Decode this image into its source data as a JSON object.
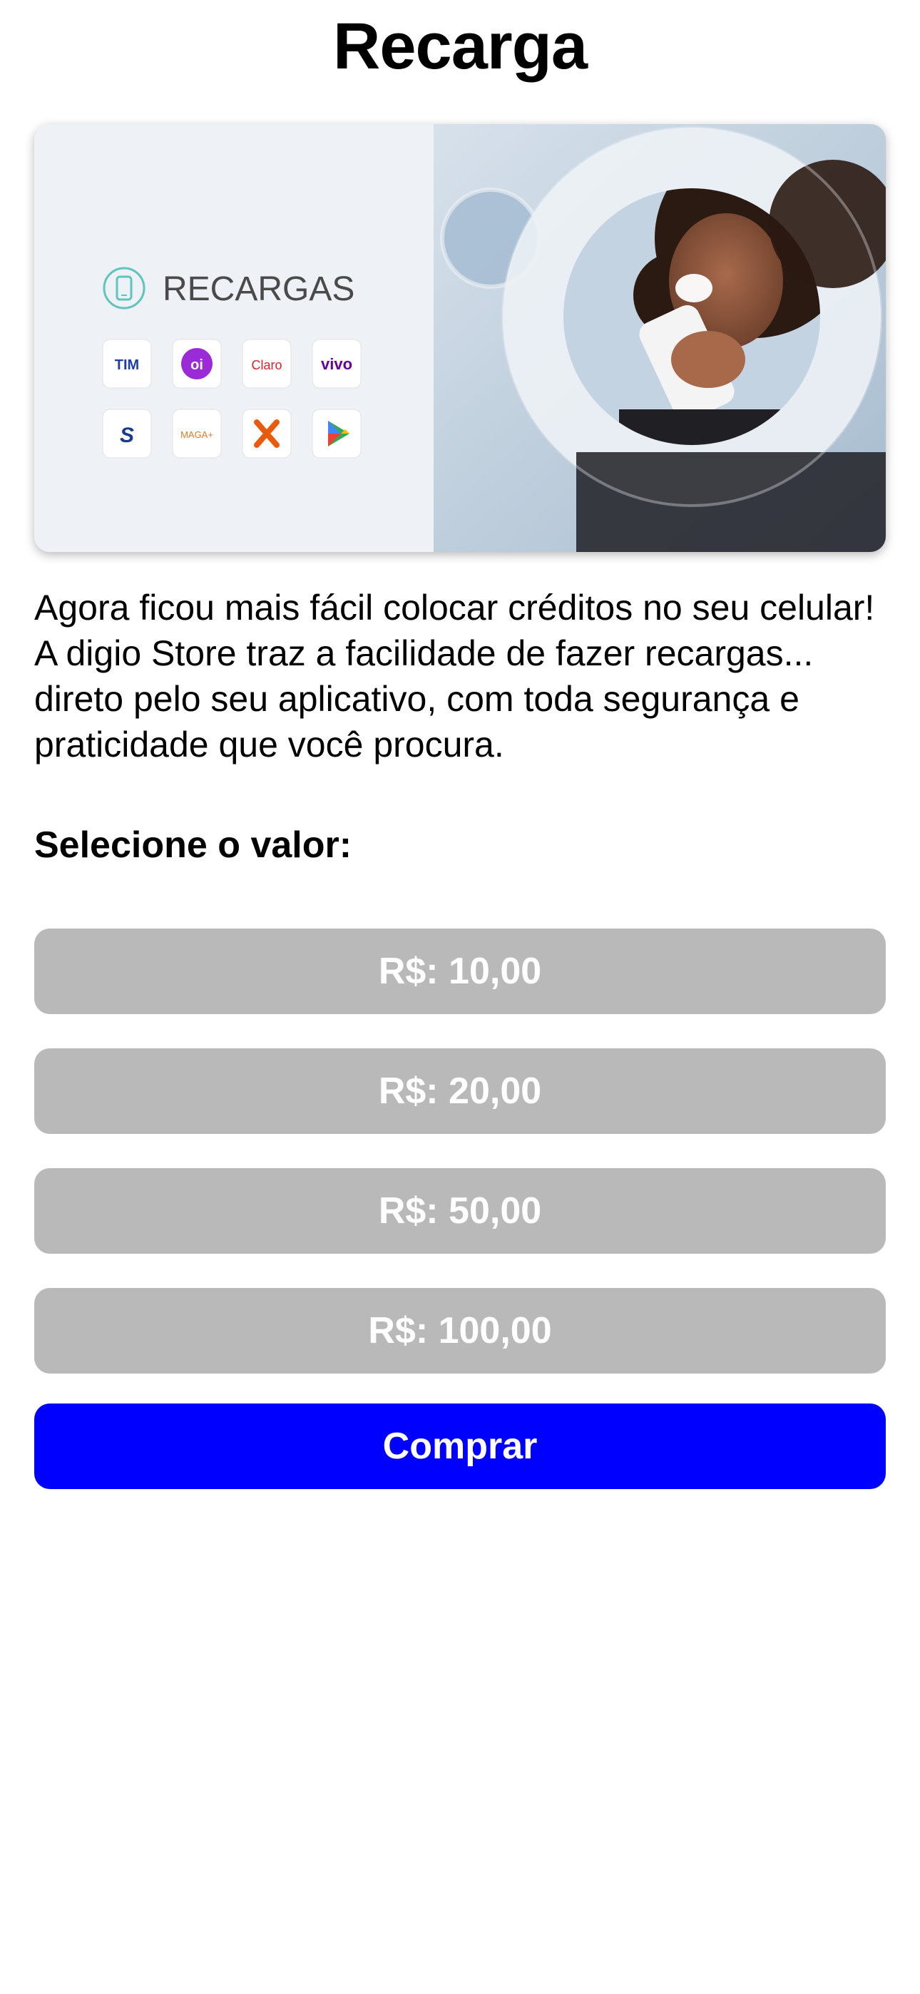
{
  "header": {
    "title": "Recarga"
  },
  "banner": {
    "heading": "RECARGAS",
    "operators": [
      {
        "name": "TIM",
        "color": "#1c3fa0",
        "icon": "tim-logo"
      },
      {
        "name": "oi",
        "color": "#9b2bd6",
        "icon": "oi-logo"
      },
      {
        "name": "Claro",
        "color": "#d8232a",
        "icon": "claro-logo"
      },
      {
        "name": "vivo",
        "color": "#660099",
        "icon": "vivo-logo"
      },
      {
        "name": "S",
        "color": "#1a3a8f",
        "icon": "sky-logo"
      },
      {
        "name": "MAGA+",
        "color": "#e07a2a",
        "icon": "magalu-logo"
      },
      {
        "name": "X",
        "color": "#e85a0c",
        "icon": "xbox-logo"
      },
      {
        "name": "play",
        "color": "#34a853",
        "icon": "google-play-logo"
      }
    ]
  },
  "description": "Agora ficou mais fácil colocar créditos no seu celular! A digio Store traz a facilidade de fazer recargas... direto pelo seu aplicativo, com toda segurança e praticidade que você procura.",
  "select_label": "Selecione o valor:",
  "values": [
    {
      "label": "R$: 10,00"
    },
    {
      "label": "R$: 20,00"
    },
    {
      "label": "R$: 50,00"
    },
    {
      "label": "R$: 100,00"
    }
  ],
  "buy_button": {
    "label": "Comprar",
    "color": "#0000ff"
  },
  "colors": {
    "value_button_bg": "#b9b9b9",
    "text": "#000000"
  }
}
